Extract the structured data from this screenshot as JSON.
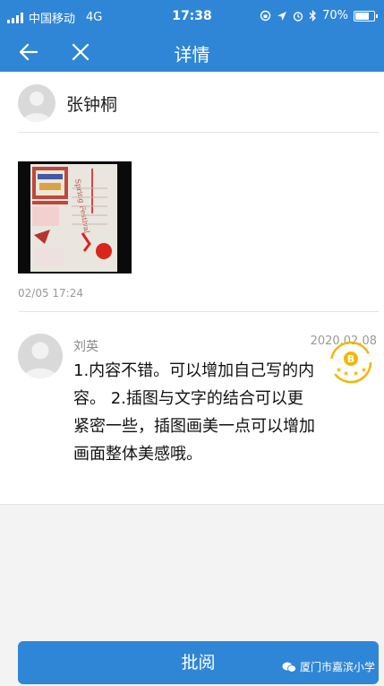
{
  "status_bar": {
    "carrier": "中国移动",
    "network": "4G",
    "time": "17:38",
    "battery": "70%",
    "battery_level": 0.7
  },
  "nav": {
    "title": "详情",
    "back_icon": "arrow-left-icon",
    "close_icon": "close-icon"
  },
  "author": {
    "name": "张钟桐"
  },
  "post": {
    "time": "02/05 17:24",
    "image_text": "Spring Festival"
  },
  "comment": {
    "name": "刘英",
    "date": "2020.02.08",
    "text": "1.内容不错。可以增加自己写的内容。 2.插图与文字的结合可以更紧密一些，插图画美一点可以增加画面整体美感哦。",
    "stamp_letter": "B"
  },
  "actions": {
    "review_label": "批阅"
  },
  "watermark": {
    "text": "厦门市嘉滨小学"
  },
  "colors": {
    "accent": "#2f86d6",
    "stamp": "#f2b705"
  }
}
